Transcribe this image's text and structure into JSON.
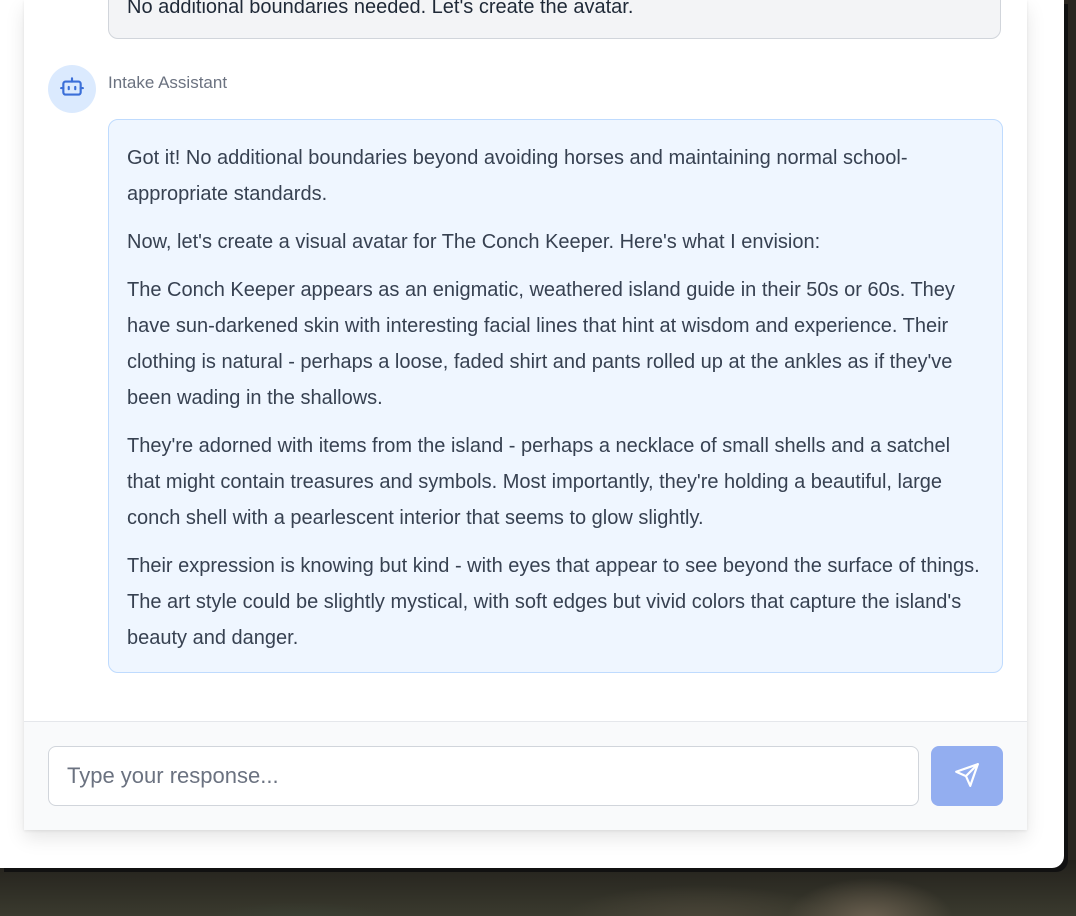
{
  "conversation": {
    "previous_user_message": "No additional boundaries needed. Let's create the avatar.",
    "assistant": {
      "sender_name": "Intake Assistant",
      "avatar_icon": "robot-icon",
      "paragraphs": [
        "Got it! No additional boundaries beyond avoiding horses and maintaining normal school-appropriate standards.",
        "Now, let's create a visual avatar for The Conch Keeper. Here's what I envision:",
        "The Conch Keeper appears as an enigmatic, weathered island guide in their 50s or 60s. They have sun-darkened skin with interesting facial lines that hint at wisdom and experience. Their clothing is natural - perhaps a loose, faded shirt and pants rolled up at the ankles as if they've been wading in the shallows.",
        "They're adorned with items from the island - perhaps a necklace of small shells and a satchel that might contain treasures and symbols. Most importantly, they're holding a beautiful, large conch shell with a pearlescent interior that seems to glow slightly.",
        "Their expression is knowing but kind - with eyes that appear to see beyond the surface of things. The art style could be slightly mystical, with soft edges but vivid colors that capture the island's beauty and danger."
      ]
    }
  },
  "composer": {
    "placeholder": "Type your response...",
    "value": "",
    "send_icon": "send-icon"
  },
  "colors": {
    "assistant_bubble_bg": "#eff6ff",
    "assistant_bubble_border": "#bfdbfe",
    "user_bubble_bg": "#f3f4f6",
    "avatar_bg": "#dbeafe",
    "accent": "#3b6fd8",
    "send_button": "#93aef0"
  }
}
